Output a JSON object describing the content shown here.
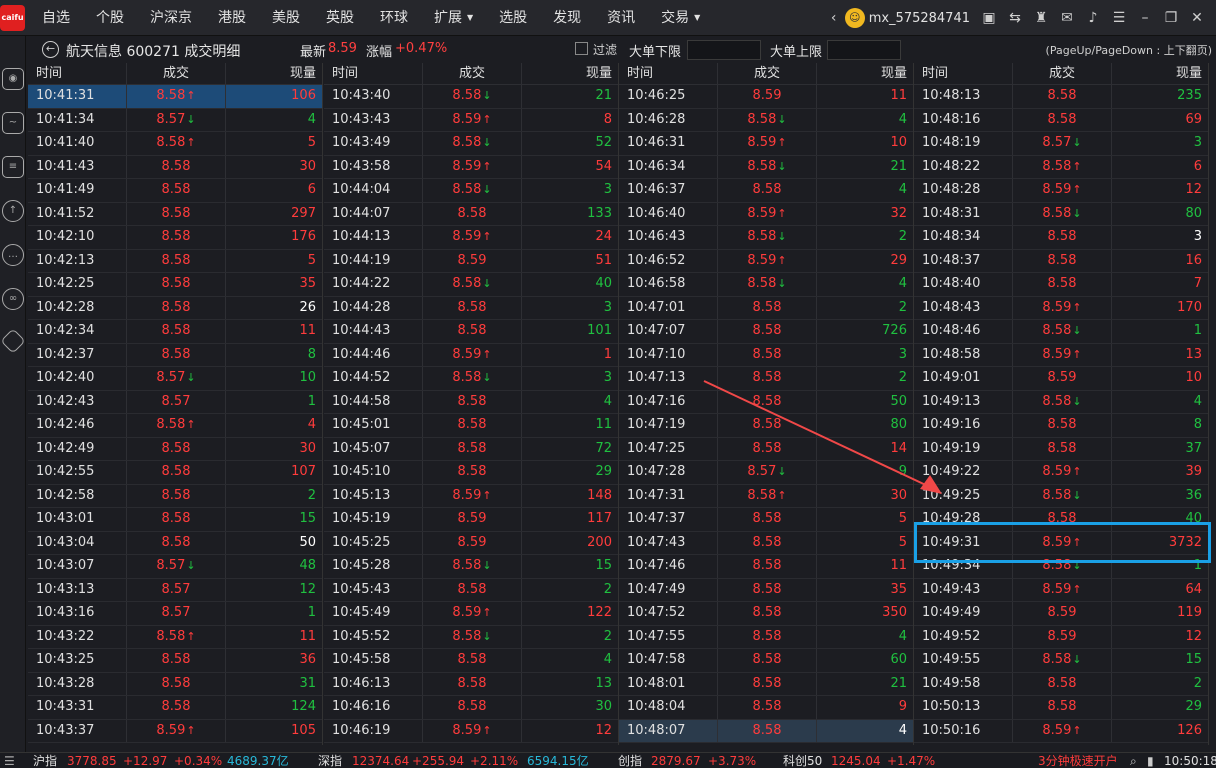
{
  "app": {
    "logo_text": "caifu",
    "menu": [
      {
        "label": "自选"
      },
      {
        "label": "个股"
      },
      {
        "label": "沪深京"
      },
      {
        "label": "港股"
      },
      {
        "label": "美股"
      },
      {
        "label": "英股"
      },
      {
        "label": "环球"
      },
      {
        "label": "扩展",
        "dropdown": true
      },
      {
        "label": "选股"
      },
      {
        "label": "发现"
      },
      {
        "label": "资讯"
      },
      {
        "label": "交易",
        "dropdown": true
      }
    ],
    "username": "mx_575284741",
    "right_icons": [
      "collapse-left-icon",
      "user-card-icon",
      "exchange-icon",
      "shirt-icon",
      "mail-icon",
      "bell-icon",
      "list-menu-icon",
      "minimize-icon",
      "restore-icon",
      "close-icon"
    ]
  },
  "sidebar": {
    "icons": [
      "robot-icon",
      "monitor-chart-icon",
      "news-doc-icon",
      "rocket-icon",
      "chat-icon",
      "link-icon",
      "diamond-icon"
    ]
  },
  "title": {
    "stock": "航天信息 600271 成交明细",
    "latest_label": "最新",
    "latest_value": "8.59",
    "change_label": "涨幅",
    "change_value": "+0.47%",
    "filter_label": "过滤",
    "min_label": "大单下限",
    "max_label": "大单上限",
    "min_value": "",
    "max_value": "",
    "page_hint": "(PageUp/PageDown : 上下翻页)"
  },
  "table": {
    "headers": {
      "time": "时间",
      "price": "成交",
      "volume": "现量"
    },
    "columns": [
      [
        [
          "10:41:31",
          "8.58",
          "up",
          "106",
          "up"
        ],
        [
          "10:41:34",
          "8.57",
          "down",
          "4",
          "down"
        ],
        [
          "10:41:40",
          "8.58",
          "up",
          "5",
          "up"
        ],
        [
          "10:41:43",
          "8.58",
          "",
          "30",
          "up"
        ],
        [
          "10:41:49",
          "8.58",
          "",
          "6",
          "up"
        ],
        [
          "10:41:52",
          "8.58",
          "",
          "297",
          "up"
        ],
        [
          "10:42:10",
          "8.58",
          "",
          "176",
          "up"
        ],
        [
          "10:42:13",
          "8.58",
          "",
          "5",
          "up"
        ],
        [
          "10:42:25",
          "8.58",
          "",
          "35",
          "up"
        ],
        [
          "10:42:28",
          "8.58",
          "",
          "26",
          "white"
        ],
        [
          "10:42:34",
          "8.58",
          "",
          "11",
          "up"
        ],
        [
          "10:42:37",
          "8.58",
          "",
          "8",
          "down"
        ],
        [
          "10:42:40",
          "8.57",
          "down",
          "10",
          "down"
        ],
        [
          "10:42:43",
          "8.57",
          "",
          "1",
          "down"
        ],
        [
          "10:42:46",
          "8.58",
          "up",
          "4",
          "up"
        ],
        [
          "10:42:49",
          "8.58",
          "",
          "30",
          "up"
        ],
        [
          "10:42:55",
          "8.58",
          "",
          "107",
          "up"
        ],
        [
          "10:42:58",
          "8.58",
          "",
          "2",
          "down"
        ],
        [
          "10:43:01",
          "8.58",
          "",
          "15",
          "down"
        ],
        [
          "10:43:04",
          "8.58",
          "",
          "50",
          "white"
        ],
        [
          "10:43:07",
          "8.57",
          "down",
          "48",
          "down"
        ],
        [
          "10:43:13",
          "8.57",
          "",
          "12",
          "down"
        ],
        [
          "10:43:16",
          "8.57",
          "",
          "1",
          "down"
        ],
        [
          "10:43:22",
          "8.58",
          "up",
          "11",
          "up"
        ],
        [
          "10:43:25",
          "8.58",
          "",
          "36",
          "up"
        ],
        [
          "10:43:28",
          "8.58",
          "",
          "31",
          "down"
        ],
        [
          "10:43:31",
          "8.58",
          "",
          "124",
          "down"
        ],
        [
          "10:43:37",
          "8.59",
          "up",
          "105",
          "up"
        ]
      ],
      [
        [
          "10:43:40",
          "8.58",
          "down",
          "21",
          "down"
        ],
        [
          "10:43:43",
          "8.59",
          "up",
          "8",
          "up"
        ],
        [
          "10:43:49",
          "8.58",
          "down",
          "52",
          "down"
        ],
        [
          "10:43:58",
          "8.59",
          "up",
          "54",
          "up"
        ],
        [
          "10:44:04",
          "8.58",
          "down",
          "3",
          "down"
        ],
        [
          "10:44:07",
          "8.58",
          "",
          "133",
          "down"
        ],
        [
          "10:44:13",
          "8.59",
          "up",
          "24",
          "up"
        ],
        [
          "10:44:19",
          "8.59",
          "",
          "51",
          "up"
        ],
        [
          "10:44:22",
          "8.58",
          "down",
          "40",
          "down"
        ],
        [
          "10:44:28",
          "8.58",
          "",
          "3",
          "down"
        ],
        [
          "10:44:43",
          "8.58",
          "",
          "101",
          "down"
        ],
        [
          "10:44:46",
          "8.59",
          "up",
          "1",
          "up"
        ],
        [
          "10:44:52",
          "8.58",
          "down",
          "3",
          "down"
        ],
        [
          "10:44:58",
          "8.58",
          "",
          "4",
          "down"
        ],
        [
          "10:45:01",
          "8.58",
          "",
          "11",
          "down"
        ],
        [
          "10:45:07",
          "8.58",
          "",
          "72",
          "down"
        ],
        [
          "10:45:10",
          "8.58",
          "",
          "29",
          "down"
        ],
        [
          "10:45:13",
          "8.59",
          "up",
          "148",
          "up"
        ],
        [
          "10:45:19",
          "8.59",
          "",
          "117",
          "up"
        ],
        [
          "10:45:25",
          "8.59",
          "",
          "200",
          "up"
        ],
        [
          "10:45:28",
          "8.58",
          "down",
          "15",
          "down"
        ],
        [
          "10:45:43",
          "8.58",
          "",
          "2",
          "down"
        ],
        [
          "10:45:49",
          "8.59",
          "up",
          "122",
          "up"
        ],
        [
          "10:45:52",
          "8.58",
          "down",
          "2",
          "down"
        ],
        [
          "10:45:58",
          "8.58",
          "",
          "4",
          "down"
        ],
        [
          "10:46:13",
          "8.58",
          "",
          "13",
          "down"
        ],
        [
          "10:46:16",
          "8.58",
          "",
          "30",
          "down"
        ],
        [
          "10:46:19",
          "8.59",
          "up",
          "12",
          "up"
        ]
      ],
      [
        [
          "10:46:25",
          "8.59",
          "",
          "11",
          "up"
        ],
        [
          "10:46:28",
          "8.58",
          "down",
          "4",
          "down"
        ],
        [
          "10:46:31",
          "8.59",
          "up",
          "10",
          "up"
        ],
        [
          "10:46:34",
          "8.58",
          "down",
          "21",
          "down"
        ],
        [
          "10:46:37",
          "8.58",
          "",
          "4",
          "down"
        ],
        [
          "10:46:40",
          "8.59",
          "up",
          "32",
          "up"
        ],
        [
          "10:46:43",
          "8.58",
          "down",
          "2",
          "down"
        ],
        [
          "10:46:52",
          "8.59",
          "up",
          "29",
          "up"
        ],
        [
          "10:46:58",
          "8.58",
          "down",
          "4",
          "down"
        ],
        [
          "10:47:01",
          "8.58",
          "",
          "2",
          "down"
        ],
        [
          "10:47:07",
          "8.58",
          "",
          "726",
          "down"
        ],
        [
          "10:47:10",
          "8.58",
          "",
          "3",
          "down"
        ],
        [
          "10:47:13",
          "8.58",
          "",
          "2",
          "down"
        ],
        [
          "10:47:16",
          "8.58",
          "",
          "50",
          "down"
        ],
        [
          "10:47:19",
          "8.58",
          "",
          "80",
          "down"
        ],
        [
          "10:47:25",
          "8.58",
          "",
          "14",
          "up"
        ],
        [
          "10:47:28",
          "8.57",
          "down",
          "9",
          "down"
        ],
        [
          "10:47:31",
          "8.58",
          "up",
          "30",
          "up"
        ],
        [
          "10:47:37",
          "8.58",
          "",
          "5",
          "up"
        ],
        [
          "10:47:43",
          "8.58",
          "",
          "5",
          "up"
        ],
        [
          "10:47:46",
          "8.58",
          "",
          "11",
          "up"
        ],
        [
          "10:47:49",
          "8.58",
          "",
          "35",
          "up"
        ],
        [
          "10:47:52",
          "8.58",
          "",
          "350",
          "up"
        ],
        [
          "10:47:55",
          "8.58",
          "",
          "4",
          "down"
        ],
        [
          "10:47:58",
          "8.58",
          "",
          "60",
          "down"
        ],
        [
          "10:48:01",
          "8.58",
          "",
          "21",
          "down"
        ],
        [
          "10:48:04",
          "8.58",
          "",
          "9",
          "up"
        ],
        [
          "10:48:07",
          "8.58",
          "",
          "4",
          "white"
        ]
      ],
      [
        [
          "10:48:13",
          "8.58",
          "",
          "235",
          "down"
        ],
        [
          "10:48:16",
          "8.58",
          "",
          "69",
          "up"
        ],
        [
          "10:48:19",
          "8.57",
          "down",
          "3",
          "down"
        ],
        [
          "10:48:22",
          "8.58",
          "up",
          "6",
          "up"
        ],
        [
          "10:48:28",
          "8.59",
          "up",
          "12",
          "up"
        ],
        [
          "10:48:31",
          "8.58",
          "down",
          "80",
          "down"
        ],
        [
          "10:48:34",
          "8.58",
          "",
          "3",
          "white"
        ],
        [
          "10:48:37",
          "8.58",
          "",
          "16",
          "up"
        ],
        [
          "10:48:40",
          "8.58",
          "",
          "7",
          "up"
        ],
        [
          "10:48:43",
          "8.59",
          "up",
          "170",
          "up"
        ],
        [
          "10:48:46",
          "8.58",
          "down",
          "1",
          "down"
        ],
        [
          "10:48:58",
          "8.59",
          "up",
          "13",
          "up"
        ],
        [
          "10:49:01",
          "8.59",
          "",
          "10",
          "up"
        ],
        [
          "10:49:13",
          "8.58",
          "down",
          "4",
          "down"
        ],
        [
          "10:49:16",
          "8.58",
          "",
          "8",
          "down"
        ],
        [
          "10:49:19",
          "8.58",
          "",
          "37",
          "down"
        ],
        [
          "10:49:22",
          "8.59",
          "up",
          "39",
          "up"
        ],
        [
          "10:49:25",
          "8.58",
          "down",
          "36",
          "down"
        ],
        [
          "10:49:28",
          "8.58",
          "",
          "40",
          "down"
        ],
        [
          "10:49:31",
          "8.59",
          "up",
          "3732",
          "up"
        ],
        [
          "10:49:34",
          "8.58",
          "down",
          "1",
          "down"
        ],
        [
          "10:49:43",
          "8.59",
          "up",
          "64",
          "up"
        ],
        [
          "10:49:49",
          "8.59",
          "",
          "119",
          "up"
        ],
        [
          "10:49:52",
          "8.59",
          "",
          "12",
          "up"
        ],
        [
          "10:49:55",
          "8.58",
          "down",
          "15",
          "down"
        ],
        [
          "10:49:58",
          "8.58",
          "",
          "2",
          "down"
        ],
        [
          "10:50:13",
          "8.58",
          "",
          "29",
          "down"
        ],
        [
          "10:50:16",
          "8.59",
          "up",
          "126",
          "up"
        ]
      ]
    ]
  },
  "status": {
    "sh_label": "沪指",
    "sh_value": "3778.85",
    "sh_change": "+12.97",
    "sh_pct": "+0.34%",
    "sh_amount": "4689.37亿",
    "sz_label": "深指",
    "sz_value": "12374.64",
    "sz_change": "+255.94",
    "sz_pct": "+2.11%",
    "sz_amount": "6594.15亿",
    "cy_label": "创指",
    "cy_value": "2879.67",
    "cy_pct": "+3.73%",
    "kc_label": "科创50",
    "kc_value": "1245.04",
    "kc_pct": "+1.47%",
    "promo": "3分钟极速开户",
    "clock": "10:50:18"
  },
  "colors": {
    "up": "#ff3c3c",
    "down": "#20c040",
    "highlight": "#1aa0e6",
    "arrow": "#f04848",
    "selected_row": "#1d4b78"
  }
}
